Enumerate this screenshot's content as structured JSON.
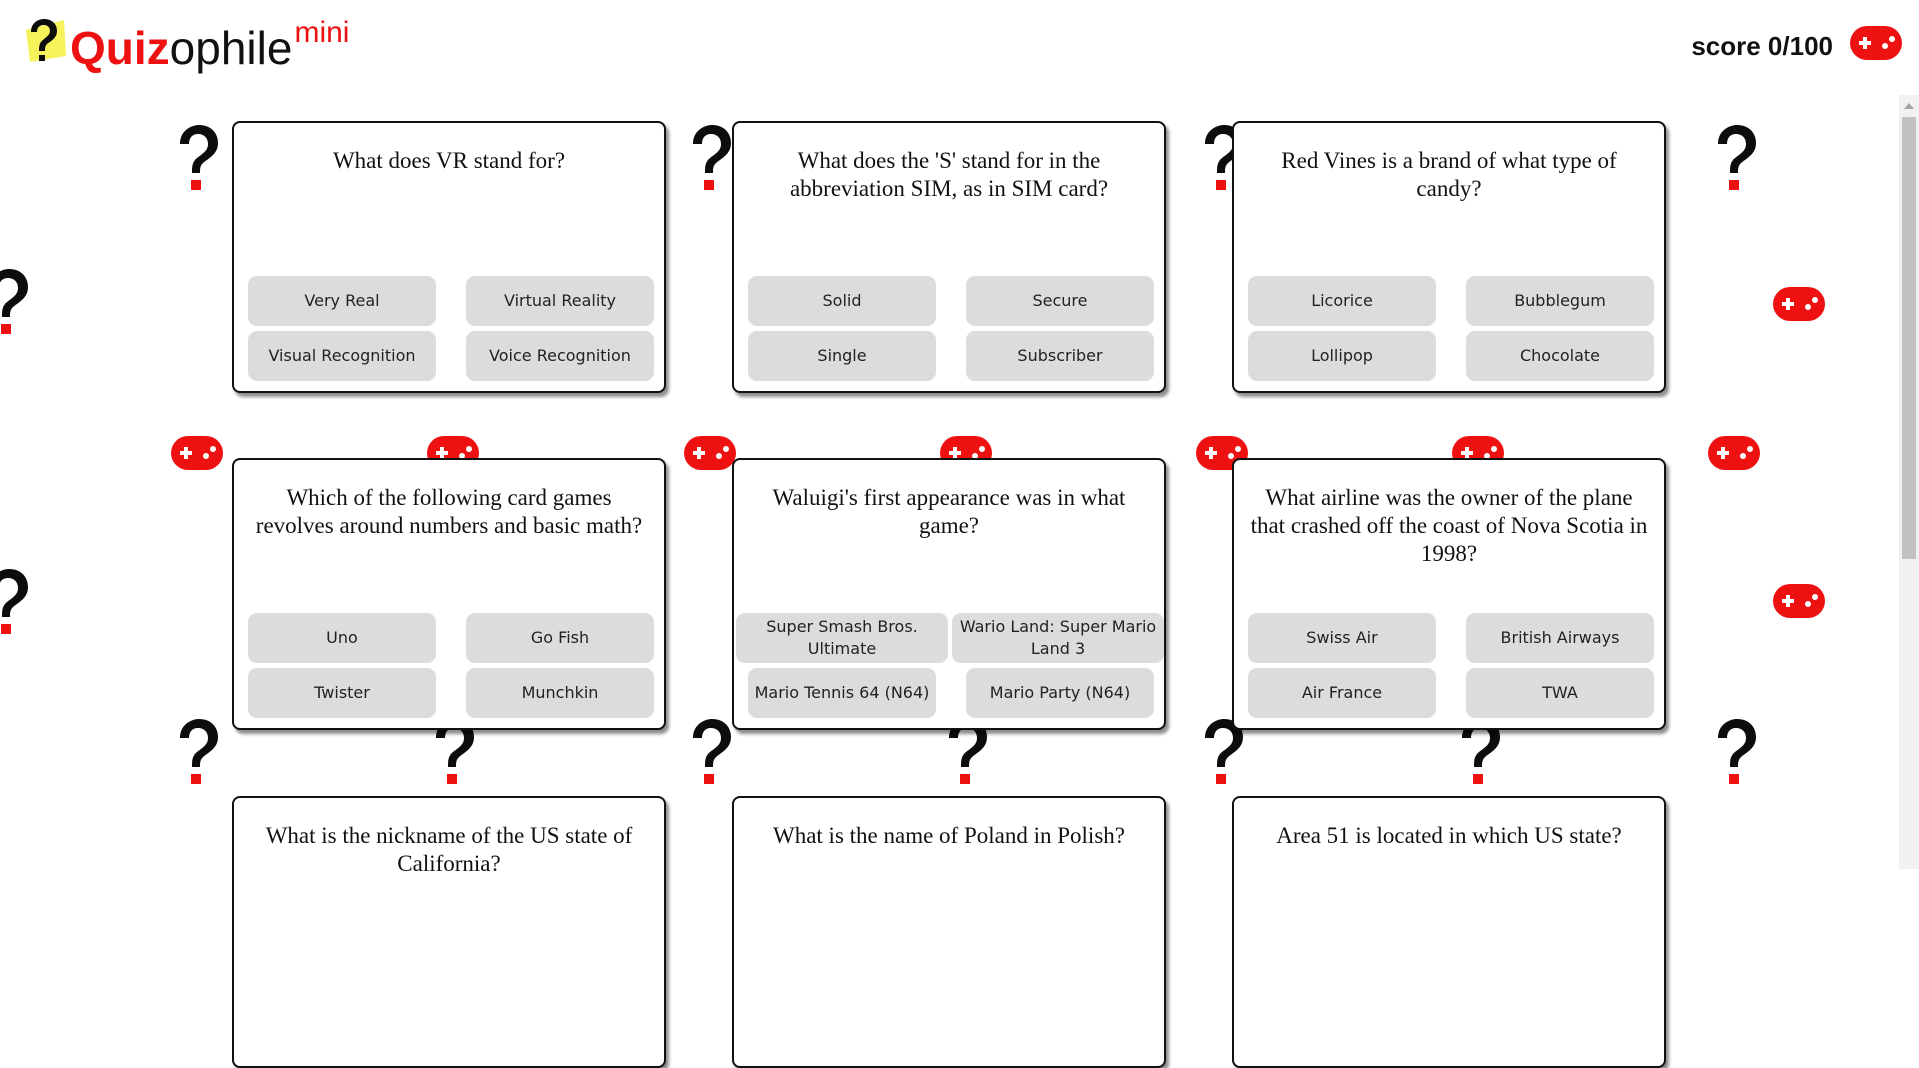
{
  "app": {
    "logo_quiz": "Quiz",
    "logo_ophile": "ophile",
    "logo_mini": "mini",
    "score": "score 0/100",
    "accent": "#ee1111"
  },
  "icons": {
    "logo": "question-mark-icon",
    "header_button": "gamepad-icon",
    "decoration_1": "question-mark-icon",
    "decoration_2": "gamepad-icon"
  },
  "cards": [
    {
      "question": "What does VR stand for?",
      "answers": [
        "Very Real",
        "Virtual Reality",
        "Visual Recognition",
        "Voice Recognition"
      ]
    },
    {
      "question": "What does the 'S' stand for in the abbreviation SIM, as in SIM card?",
      "answers": [
        "Solid",
        "Secure",
        "Single",
        "Subscriber"
      ]
    },
    {
      "question": "Red Vines is a brand of what type of candy?",
      "answers": [
        "Licorice",
        "Bubblegum",
        "Lollipop",
        "Chocolate"
      ]
    },
    {
      "question": "Which of the following card games revolves around numbers and basic math?",
      "answers": [
        "Uno",
        "Go Fish",
        "Twister",
        "Munchkin"
      ]
    },
    {
      "question": "Waluigi's first appearance was in what game?",
      "answers": [
        "Super Smash Bros. Ultimate",
        "Wario Land: Super Mario Land 3",
        "Mario Tennis 64 (N64)",
        "Mario Party (N64)"
      ]
    },
    {
      "question": "What airline was the owner of the plane that crashed off the coast of Nova Scotia in 1998?",
      "answers": [
        "Swiss Air",
        "British Airways",
        "Air France",
        "TWA"
      ]
    },
    {
      "question": "What is the nickname of the US state of California?",
      "answers": []
    },
    {
      "question": "What is the name of Poland in Polish?",
      "answers": []
    },
    {
      "question": "Area 51 is located in which US state?",
      "answers": []
    }
  ]
}
